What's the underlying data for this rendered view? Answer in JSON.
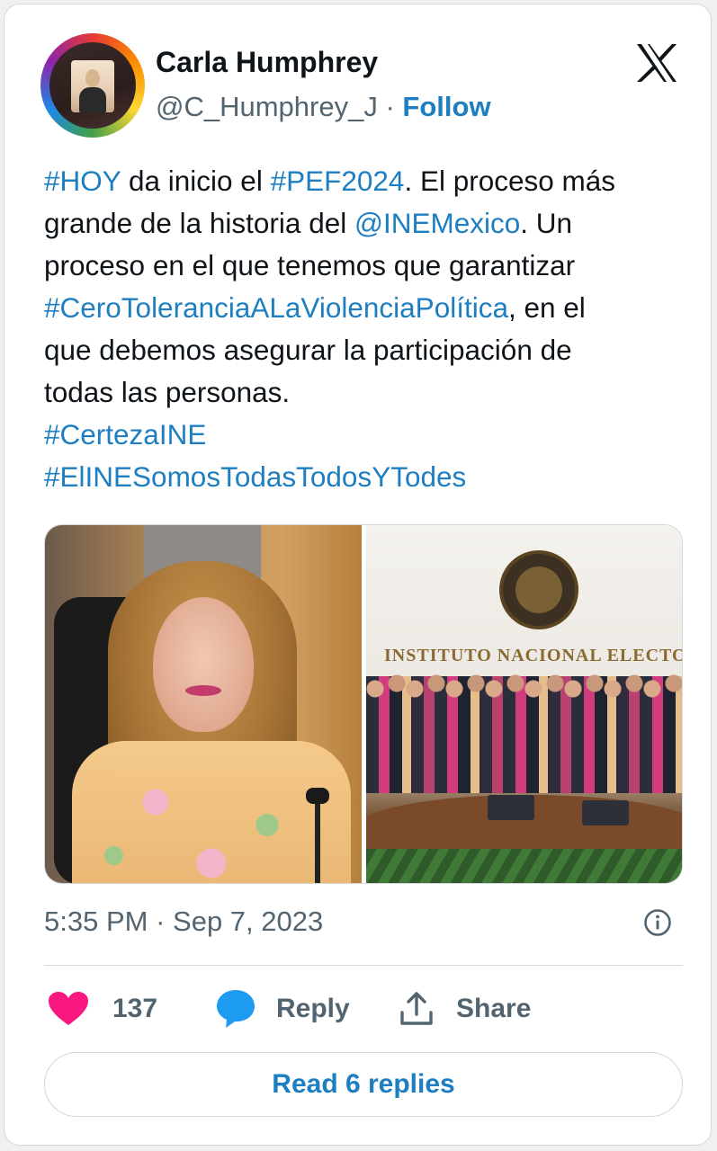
{
  "author": {
    "name": "Carla Humphrey",
    "handle": "@C_Humphrey_J",
    "separator": "·",
    "follow_label": "Follow"
  },
  "platform_icon": "x-logo-icon",
  "tweet": {
    "lines": [
      [
        {
          "t": "#HOY",
          "link": true
        },
        {
          "t": " da inicio el ",
          "link": false
        },
        {
          "t": "#PEF2024",
          "link": true
        },
        {
          "t": ". El proceso más",
          "link": false
        }
      ],
      [
        {
          "t": "grande de la historia del ",
          "link": false
        },
        {
          "t": "@INEMexico",
          "link": true
        },
        {
          "t": ". Un",
          "link": false
        }
      ],
      [
        {
          "t": "proceso en el que tenemos que garantizar",
          "link": false
        }
      ],
      [
        {
          "t": "#CeroToleranciaALaViolenciaPolítica",
          "link": true
        },
        {
          "t": ", en el",
          "link": false
        }
      ],
      [
        {
          "t": "que debemos asegurar la participación de",
          "link": false
        }
      ],
      [
        {
          "t": "todas las personas.",
          "link": false
        }
      ],
      [
        {
          "t": "#CertezaINE",
          "link": true
        }
      ],
      [
        {
          "t": "#ElINESomosTodasTodosYTodes",
          "link": true
        }
      ]
    ]
  },
  "media": {
    "right_photo_sign": "INSTITUTO NACIONAL ELECTORA"
  },
  "meta": {
    "time": "5:35 PM",
    "separator": "·",
    "date": "Sep 7, 2023"
  },
  "actions": {
    "like_count": "137",
    "reply_label": "Reply",
    "share_label": "Share"
  },
  "read_replies_label": "Read 6 replies",
  "colors": {
    "link": "#1d7fc1",
    "like": "#f91880",
    "reply_icon": "#1d9bf0",
    "muted_text": "#536471"
  }
}
